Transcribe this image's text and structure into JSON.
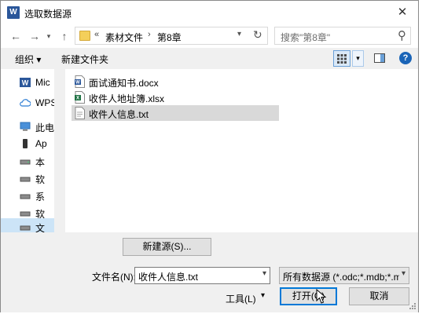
{
  "window": {
    "title": "选取数据源",
    "app_icon_letter": "W"
  },
  "address": {
    "overflow": "«",
    "segments": [
      "素材文件",
      "第8章"
    ]
  },
  "search": {
    "placeholder": "搜索\"第8章\""
  },
  "toolbar": {
    "organize": "组织 ▾",
    "new_folder": "新建文件夹"
  },
  "nav_pane": {
    "items": [
      {
        "label": "Mic",
        "icon": "word-icon"
      },
      {
        "label": "WPS",
        "icon": "cloud-icon"
      },
      {
        "label": "此电",
        "icon": "computer-icon"
      },
      {
        "label": "Ap",
        "icon": "phone-icon"
      },
      {
        "label": "本",
        "icon": "drive-icon"
      },
      {
        "label": "软",
        "icon": "drive-icon"
      },
      {
        "label": "系",
        "icon": "drive-icon"
      },
      {
        "label": "软",
        "icon": "drive-icon"
      },
      {
        "label": "文",
        "icon": "drive-icon"
      }
    ]
  },
  "files": [
    {
      "name": "面试通知书.docx",
      "icon": "docx-icon"
    },
    {
      "name": "收件人地址簿.xlsx",
      "icon": "xlsx-icon"
    },
    {
      "name": "收件人信息.txt",
      "icon": "txt-icon"
    }
  ],
  "bottom": {
    "new_source": "新建源(S)...",
    "filename_label": "文件名(N):",
    "filename_value": "收件人信息.txt",
    "filetype_value": "所有数据源 (*.odc;*.mdb;*.md",
    "tools": "工具(L)",
    "open": "打开(O)",
    "cancel": "取消"
  },
  "colors": {
    "selection": "#d9d9d9",
    "nav_selection": "#cce4f7",
    "accent": "#0078d7",
    "word": "#2b579a",
    "excel": "#217346",
    "folder": "#f4cf5a"
  }
}
